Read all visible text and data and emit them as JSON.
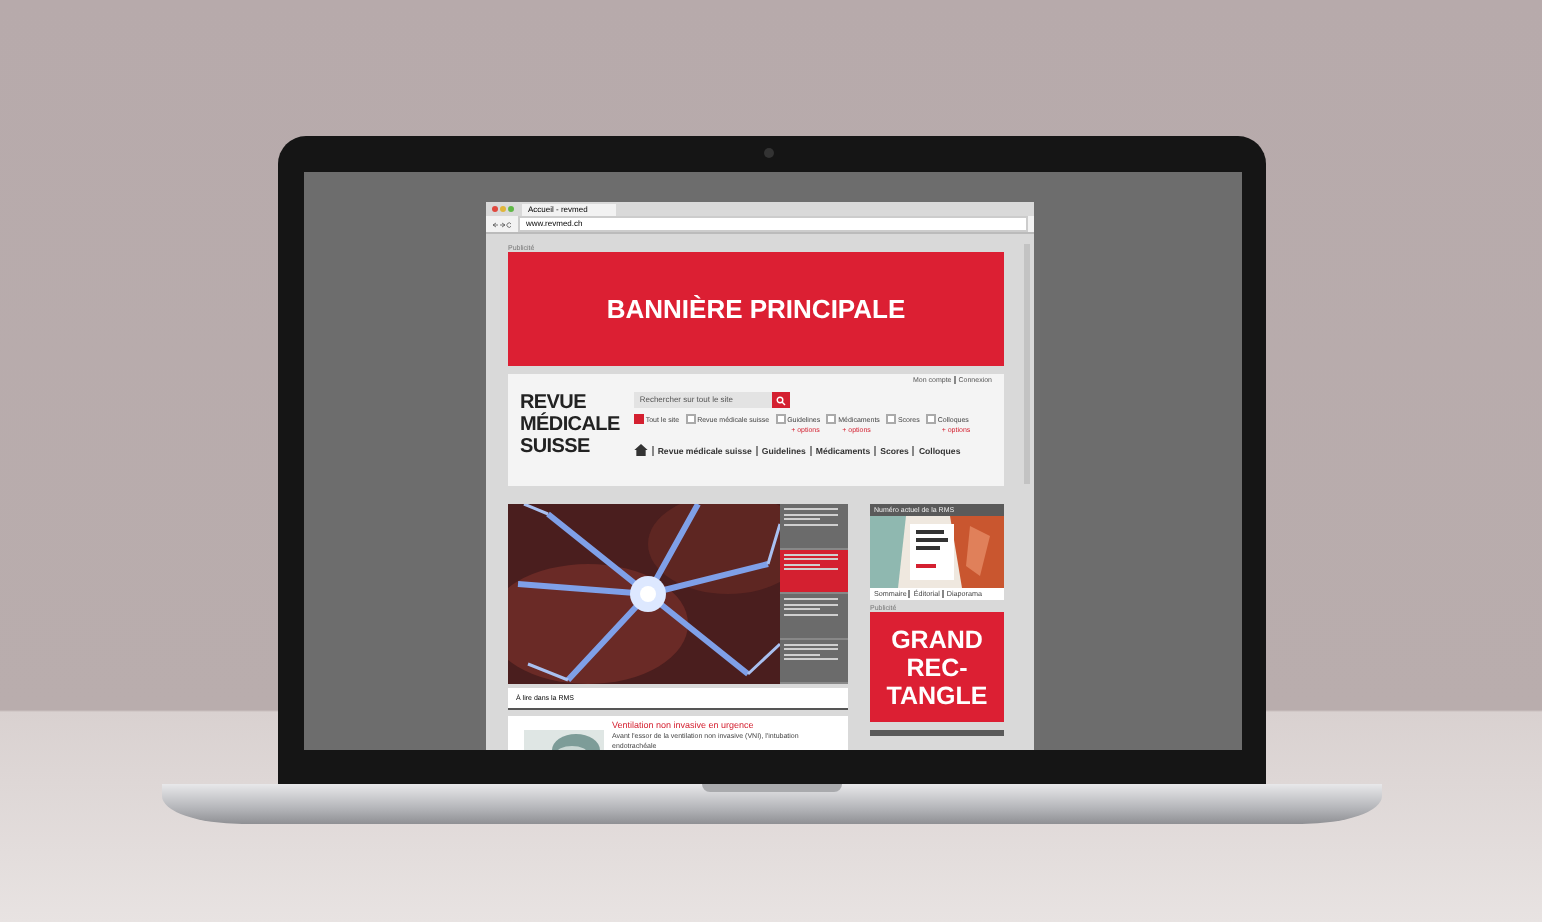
{
  "browser": {
    "tab_title": "Accueil - revmed",
    "url": "www.revmed.ch"
  },
  "top_ad": {
    "label": "Publicité",
    "text": "BANNIÈRE PRINCIPALE"
  },
  "account_links": [
    "Mon compte",
    "Connexion"
  ],
  "logo": [
    "REVUE",
    "MÉDICALE",
    "SUISSE"
  ],
  "search": {
    "placeholder": "Rechercher sur tout le site"
  },
  "filters": [
    {
      "label": "Tout le site",
      "checked": true
    },
    {
      "label": "Revue médicale suisse",
      "checked": false
    },
    {
      "label": "Guidelines",
      "checked": false,
      "options": "+ options"
    },
    {
      "label": "Médicaments",
      "checked": false,
      "options": "+ options"
    },
    {
      "label": "Scores",
      "checked": false
    },
    {
      "label": "Colloques",
      "checked": false,
      "options": "+ options"
    }
  ],
  "nav": [
    "Revue médicale suisse",
    "Guidelines",
    "Médicaments",
    "Scores",
    "Colloques"
  ],
  "hero": {
    "teasers": [
      {
        "selected": false
      },
      {
        "selected": true
      },
      {
        "selected": false
      },
      {
        "selected": false
      }
    ]
  },
  "section_title": "À lire dans la RMS",
  "article": {
    "title": "Ventilation non invasive en urgence",
    "snippet": "Avant l'essor de la ventilation non invasive (VNI), l'intubation endotrachéale"
  },
  "current_issue": {
    "heading": "Numéro actuel de la RMS",
    "links": [
      "Sommaire",
      "Éditorial",
      "Diaporama"
    ]
  },
  "side_ad": {
    "label": "Publicité",
    "lines": [
      "GRAND",
      "REC-",
      "TANGLE"
    ]
  }
}
